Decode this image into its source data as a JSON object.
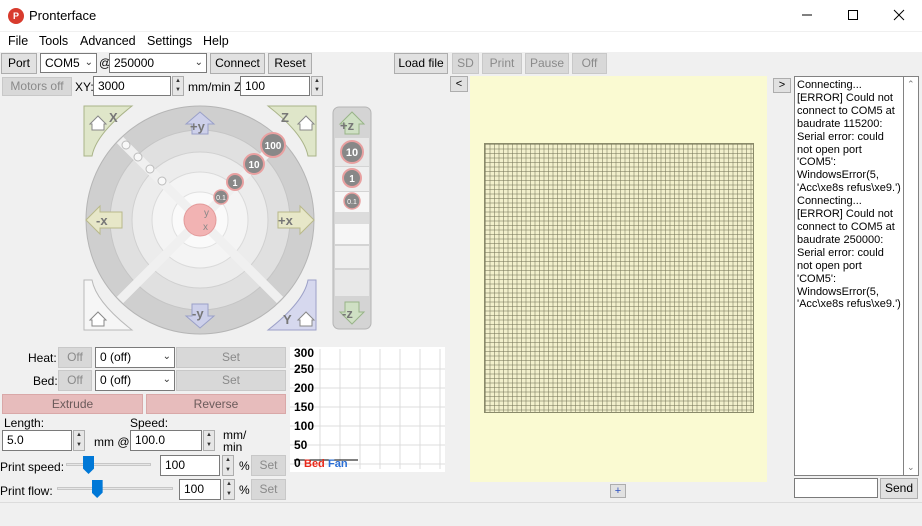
{
  "window": {
    "title": "Pronterface",
    "icon_text": "P"
  },
  "menu": [
    "File",
    "Tools",
    "Advanced",
    "Settings",
    "Help"
  ],
  "connection": {
    "port_label": "Port",
    "port_value": "COM5",
    "at": "@",
    "baud_value": "250000",
    "connect_label": "Connect",
    "reset_label": "Reset"
  },
  "file_controls": {
    "load_label": "Load file",
    "sd_label": "SD",
    "print_label": "Print",
    "pause_label": "Pause",
    "off_label": "Off"
  },
  "motors": {
    "motors_off_label": "Motors off",
    "xy_label": "XY:",
    "xy_feed": "3000",
    "unit_label": "mm/min Z:",
    "z_feed": "100"
  },
  "jog": {
    "home_x": "X",
    "home_z": "Z",
    "home_y": "Y",
    "plus_y": "+y",
    "minus_y": "-y",
    "plus_x": "+x",
    "minus_x": "-x",
    "steps": [
      "100",
      "10",
      "1",
      "0.1"
    ],
    "center_y": "y",
    "center_x": "x",
    "plus_z": "+z",
    "minus_z": "-z",
    "z_steps": [
      "10",
      "1",
      "0.1"
    ]
  },
  "temps": {
    "heat_label": "Heat:",
    "heat_off": "Off",
    "heat_value": "0 (off)",
    "heat_set": "Set",
    "bed_label": "Bed:",
    "bed_off": "Off",
    "bed_value": "0 (off)",
    "bed_set": "Set"
  },
  "extrude": {
    "extrude_label": "Extrude",
    "reverse_label": "Reverse",
    "length_label": "Length:",
    "speed_label": "Speed:",
    "length_value": "5.0",
    "mm_at": "mm @",
    "speed_value": "100.0",
    "mm_min": "mm/\nmin"
  },
  "speed": {
    "print_speed_label": "Print speed:",
    "print_speed_value": "100",
    "speed_pct": "%",
    "speed_set": "Set",
    "print_speed_level": 0.23,
    "print_flow_label": "Print flow:",
    "print_flow_value": "100",
    "flow_pct": "%",
    "flow_set": "Set",
    "print_flow_level": 0.33
  },
  "graph": {
    "y_ticks": [
      "300",
      "250",
      "200",
      "150",
      "100",
      "50",
      "0"
    ],
    "legend_bed": "Bed",
    "legend_fan": "Fan"
  },
  "view": {
    "collapse_left": "<",
    "expand_right": ">",
    "zoom_plus": "+"
  },
  "log": {
    "text": "Connecting...\n[ERROR] Could not connect to COM5 at baudrate 115200:\nSerial error: could not open port 'COM5': WindowsError(5, 'Acc\\xe8s refus\\xe9.')\nConnecting...\n[ERROR] Could not connect to COM5 at baudrate 250000:\nSerial error: could not open port 'COM5': WindowsError(5, 'Acc\\xe8s refus\\xe9.')",
    "command_value": "",
    "send_label": "Send"
  },
  "colors": {
    "graph_bed": "#e8281a",
    "graph_fan": "#2a6fd6",
    "view_bg": "#fafad2"
  }
}
